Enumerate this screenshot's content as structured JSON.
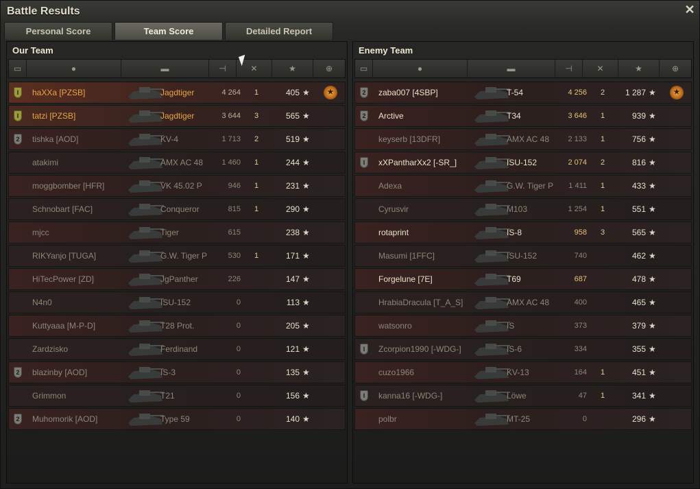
{
  "window": {
    "title": "Battle Results"
  },
  "tabs": [
    "Personal Score",
    "Team Score",
    "Detailed Report"
  ],
  "active_tab": 1,
  "our_team": {
    "title": "Our Team",
    "rows": [
      {
        "badge": "I",
        "badge_color": "gold",
        "name": "haXXa [PZSB]",
        "vehicle": "Jagdtiger",
        "damage": "4 264",
        "kills": "1",
        "xp": "405",
        "medal": true,
        "style": "gold"
      },
      {
        "badge": "I",
        "badge_color": "gold",
        "name": "tatzi [PZSB]",
        "vehicle": "Jagdtiger",
        "damage": "3 644",
        "kills": "3",
        "xp": "565",
        "medal": false,
        "style": "gold"
      },
      {
        "badge": "2",
        "badge_color": "grey",
        "name": "tishka [AOD]",
        "vehicle": "KV-4",
        "damage": "1 713",
        "kills": "2",
        "xp": "519",
        "medal": false,
        "style": "dim"
      },
      {
        "badge": "",
        "badge_color": "",
        "name": "atakimi",
        "vehicle": "AMX AC 48",
        "damage": "1 460",
        "kills": "1",
        "xp": "244",
        "medal": false,
        "style": "dim"
      },
      {
        "badge": "",
        "badge_color": "",
        "name": "moggbomber [HFR]",
        "vehicle": "VK 45.02 P",
        "damage": "946",
        "kills": "1",
        "xp": "231",
        "medal": false,
        "style": "dim"
      },
      {
        "badge": "",
        "badge_color": "",
        "name": "Schnobart [FAC]",
        "vehicle": "Conqueror",
        "damage": "815",
        "kills": "1",
        "xp": "290",
        "medal": false,
        "style": "dim"
      },
      {
        "badge": "",
        "badge_color": "",
        "name": "mjcc",
        "vehicle": "Tiger",
        "damage": "615",
        "kills": "",
        "xp": "238",
        "medal": false,
        "style": "dim"
      },
      {
        "badge": "",
        "badge_color": "",
        "name": "RIKYanjo [TUGA]",
        "vehicle": "G.W. Tiger P",
        "damage": "530",
        "kills": "1",
        "xp": "171",
        "medal": false,
        "style": "dim"
      },
      {
        "badge": "",
        "badge_color": "",
        "name": "HiTecPower [ZD]",
        "vehicle": "JgPanther",
        "damage": "226",
        "kills": "",
        "xp": "147",
        "medal": false,
        "style": "dim"
      },
      {
        "badge": "",
        "badge_color": "",
        "name": "N4n0",
        "vehicle": "ISU-152",
        "damage": "0",
        "kills": "",
        "xp": "113",
        "medal": false,
        "style": "dim"
      },
      {
        "badge": "",
        "badge_color": "",
        "name": "Kuttyaaa [M-P-D]",
        "vehicle": "T28 Prot.",
        "damage": "0",
        "kills": "",
        "xp": "205",
        "medal": false,
        "style": "dim"
      },
      {
        "badge": "",
        "badge_color": "",
        "name": "Zardzisko",
        "vehicle": "Ferdinand",
        "damage": "0",
        "kills": "",
        "xp": "121",
        "medal": false,
        "style": "dim"
      },
      {
        "badge": "2",
        "badge_color": "grey",
        "name": "blazinby [AOD]",
        "vehicle": "IS-3",
        "damage": "0",
        "kills": "",
        "xp": "135",
        "medal": false,
        "style": "dim"
      },
      {
        "badge": "",
        "badge_color": "",
        "name": "Grimmon",
        "vehicle": "T21",
        "damage": "0",
        "kills": "",
        "xp": "156",
        "medal": false,
        "style": "dim"
      },
      {
        "badge": "2",
        "badge_color": "grey",
        "name": "Muhomorik [AOD]",
        "vehicle": "Type 59",
        "damage": "0",
        "kills": "",
        "xp": "140",
        "medal": false,
        "style": "dim"
      }
    ]
  },
  "enemy_team": {
    "title": "Enemy Team",
    "rows": [
      {
        "badge": "2",
        "badge_color": "grey",
        "name": "zaba007 [4SBP]",
        "vehicle": "T-54",
        "damage": "4 256",
        "kills": "2",
        "xp": "1 287",
        "medal": true,
        "style": "bright"
      },
      {
        "badge": "2",
        "badge_color": "grey",
        "name": "Arctive",
        "vehicle": "T34",
        "damage": "3 646",
        "kills": "1",
        "xp": "939",
        "medal": false,
        "style": "bright"
      },
      {
        "badge": "",
        "badge_color": "",
        "name": "keyserb [13DFR]",
        "vehicle": "AMX AC 48",
        "damage": "2 133",
        "kills": "1",
        "xp": "756",
        "medal": false,
        "style": "dim"
      },
      {
        "badge": "I",
        "badge_color": "grey",
        "name": "xXPantharXx2 [-SR_]",
        "vehicle": "ISU-152",
        "damage": "2 074",
        "kills": "2",
        "xp": "816",
        "medal": false,
        "style": "bright"
      },
      {
        "badge": "",
        "badge_color": "",
        "name": "Adexa",
        "vehicle": "G.W. Tiger P",
        "damage": "1 411",
        "kills": "1",
        "xp": "433",
        "medal": false,
        "style": "dim"
      },
      {
        "badge": "",
        "badge_color": "",
        "name": "Cyrusvir",
        "vehicle": "M103",
        "damage": "1 254",
        "kills": "1",
        "xp": "551",
        "medal": false,
        "style": "dim"
      },
      {
        "badge": "",
        "badge_color": "",
        "name": "rotaprint",
        "vehicle": "IS-8",
        "damage": "958",
        "kills": "3",
        "xp": "565",
        "medal": false,
        "style": "bright"
      },
      {
        "badge": "",
        "badge_color": "",
        "name": "Masumi [1FFC]",
        "vehicle": "ISU-152",
        "damage": "740",
        "kills": "",
        "xp": "462",
        "medal": false,
        "style": "dim"
      },
      {
        "badge": "",
        "badge_color": "",
        "name": "Forgelune [7E]",
        "vehicle": "T69",
        "damage": "687",
        "kills": "",
        "xp": "478",
        "medal": false,
        "style": "bright"
      },
      {
        "badge": "",
        "badge_color": "",
        "name": "HrabiaDracula [T_A_S]",
        "vehicle": "AMX AC 48",
        "damage": "400",
        "kills": "",
        "xp": "465",
        "medal": false,
        "style": "dim"
      },
      {
        "badge": "",
        "badge_color": "",
        "name": "watsonro",
        "vehicle": "IS",
        "damage": "373",
        "kills": "",
        "xp": "379",
        "medal": false,
        "style": "dim"
      },
      {
        "badge": "I",
        "badge_color": "grey",
        "name": "Zcorpion1990 [-WDG-]",
        "vehicle": "IS-6",
        "damage": "334",
        "kills": "",
        "xp": "355",
        "medal": false,
        "style": "dim"
      },
      {
        "badge": "",
        "badge_color": "",
        "name": "cuzo1966",
        "vehicle": "KV-13",
        "damage": "164",
        "kills": "1",
        "xp": "451",
        "medal": false,
        "style": "dim"
      },
      {
        "badge": "I",
        "badge_color": "grey",
        "name": "kanna16 [-WDG-]",
        "vehicle": "Löwe",
        "damage": "47",
        "kills": "1",
        "xp": "341",
        "medal": false,
        "style": "dim"
      },
      {
        "badge": "",
        "badge_color": "",
        "name": "polbr",
        "vehicle": "MT-25",
        "damage": "0",
        "kills": "",
        "xp": "296",
        "medal": false,
        "style": "dim"
      }
    ]
  },
  "icons": {
    "close": "close-icon",
    "columns": [
      "badge-column-icon",
      "player-column-icon",
      "tank-column-icon",
      "damage-column-icon",
      "kills-column-icon",
      "xp-column-icon",
      "medal-column-icon"
    ]
  },
  "colors": {
    "gold_text": "#e8a544",
    "bright_text": "#e8e2cc",
    "dim_text": "#8c8778",
    "damage_highlight": "#e3c27a"
  }
}
